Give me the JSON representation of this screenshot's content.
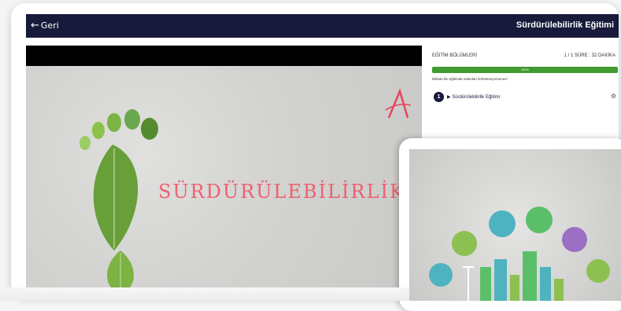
{
  "header": {
    "back_label": "Geri",
    "course_title": "Sürdürülebilirlik Eğitimi"
  },
  "video": {
    "slide_title": "SÜRDÜRÜLEBİLİRLİK"
  },
  "panel": {
    "sections_label": "EĞİTİM BÖLÜMLERİ",
    "summary": "1 / 1 SÜRE : 32 DAKİKA",
    "progress": 100,
    "progress_label": "100%",
    "warning": "Dikkat! Bu eğitimde videoları ilerletemiyorsunuz!",
    "lessons": [
      {
        "number": "1",
        "label": "▶ Sürdürülebilirlik Eğitimi"
      }
    ]
  },
  "colors": {
    "header_bg": "#171a3b",
    "progress": "#3f9a2f",
    "slide_title": "#f0606e"
  }
}
